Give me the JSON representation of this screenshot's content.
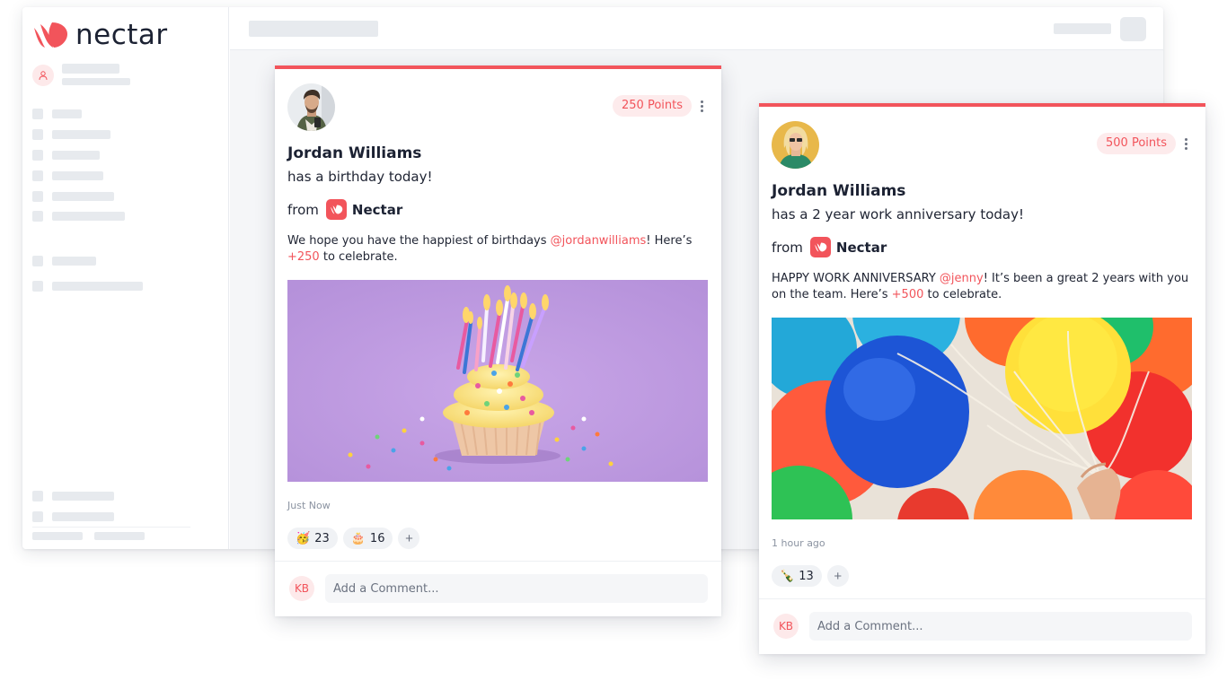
{
  "app": {
    "brand_name": "nectar",
    "brand_color": "#f2545b"
  },
  "posts": [
    {
      "author": "Jordan Williams",
      "event": "has a birthday today!",
      "points": "250 Points",
      "from_label": "from",
      "from_name": "Nectar",
      "message": {
        "before": "We hope you have the happiest of birthdays ",
        "mention": "@jordanwilliams",
        "middle": "! Here’s ",
        "bonus": "+250",
        "after": " to celebrate."
      },
      "image_desc": "birthday-cupcake-image",
      "timestamp": "Just Now",
      "reactions": [
        {
          "emoji": "🥳",
          "icon": "party-face-icon",
          "count": "23"
        },
        {
          "emoji": "🎂",
          "icon": "birthday-cake-icon",
          "count": "16"
        }
      ],
      "add_reaction": "+",
      "commenter_initials": "KB",
      "comment_placeholder": "Add a Comment..."
    },
    {
      "author": "Jordan Williams",
      "event": "has a 2 year work anniversary today!",
      "points": "500 Points",
      "from_label": "from",
      "from_name": "Nectar",
      "message": {
        "before": "HAPPY WORK ANNIVERSARY ",
        "mention": "@jenny",
        "middle": "! It’s been a great 2 years with you on the team. Here’s ",
        "bonus": "+500",
        "after": " to celebrate."
      },
      "image_desc": "balloons-image",
      "timestamp": "1 hour ago",
      "reactions": [
        {
          "emoji": "🍾",
          "icon": "champagne-bottle-icon",
          "count": "13"
        }
      ],
      "add_reaction": "+",
      "commenter_initials": "KB",
      "comment_placeholder": "Add a Comment..."
    }
  ]
}
